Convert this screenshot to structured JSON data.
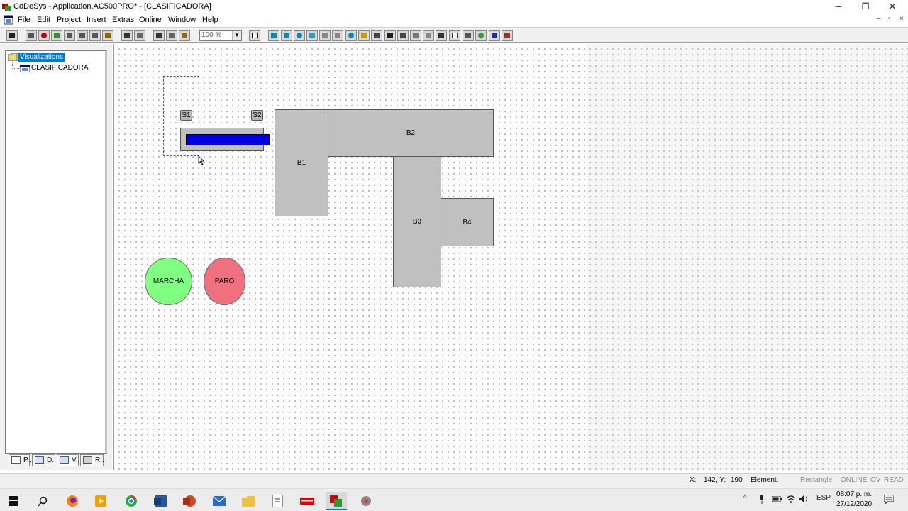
{
  "window": {
    "title": "CoDeSys - Application.AC500PRO* - [CLASIFICADORA]",
    "minimize_glyph": "─",
    "restore_glyph": "❐",
    "close_glyph": "✕"
  },
  "menu": {
    "items": [
      "File",
      "Edit",
      "Project",
      "Insert",
      "Extras",
      "Online",
      "Window",
      "Help"
    ],
    "mdi_min": "–",
    "mdi_restore": "▫",
    "mdi_close": "×"
  },
  "toolbar": {
    "zoom_value": "100 %",
    "zoom_arrow": "▼"
  },
  "tree": {
    "root_label": "Visualizations",
    "child_label": "CLASIFICADORA"
  },
  "left_tabs": [
    "P..",
    "D..",
    "V..",
    "R.."
  ],
  "canvas": {
    "labels": {
      "s1": "S1",
      "s2": "S2",
      "b1": "B1",
      "b2": "B2",
      "b3": "B3",
      "b4": "B4",
      "marcha": "MARCHA",
      "paro": "PARO"
    },
    "colors": {
      "shape_fill": "#c0c0c0",
      "bar_fill": "#0000e0",
      "marcha_fill": "#80ff80",
      "paro_fill": "#f07080"
    }
  },
  "status": {
    "coords_label": "X:",
    "x_value": "142",
    "y_label": ", Y:",
    "y_value": "190",
    "element_label": "Element:",
    "element_type": "Rectangle",
    "online": "ONLINE",
    "ov": "OV",
    "read": "READ"
  },
  "taskbar": {
    "apps": [
      "start-icon",
      "search-icon",
      "firefox-icon",
      "app-icon",
      "chrome-icon",
      "word-icon",
      "powerpoint-icon",
      "mail-icon",
      "explorer-icon",
      "notepad-icon",
      "abb-icon",
      "codesys-icon",
      "codesys-2-icon"
    ],
    "language": "ESP",
    "time": "08:07 p. m.",
    "date": "27/12/2020"
  }
}
